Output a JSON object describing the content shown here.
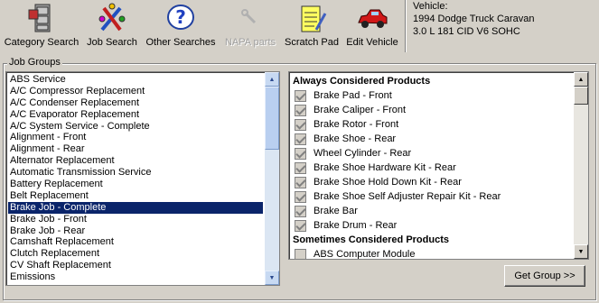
{
  "toolbar": {
    "buttons": [
      {
        "label": "Category Search",
        "icon": "file-cabinet-icon",
        "enabled": true
      },
      {
        "label": "Job Search",
        "icon": "tools-icon",
        "enabled": true
      },
      {
        "label": "Other Searches",
        "icon": "question-icon",
        "enabled": true
      },
      {
        "label": "NAPA parts",
        "icon": "wrench-icon",
        "enabled": false
      },
      {
        "label": "Scratch Pad",
        "icon": "notepad-icon",
        "enabled": true
      },
      {
        "label": "Edit Vehicle",
        "icon": "car-icon",
        "enabled": true
      }
    ]
  },
  "vehicle": {
    "heading": "Vehicle:",
    "line1": "1994 Dodge Truck Caravan",
    "line2": "3.0 L 181 CID V6 SOHC"
  },
  "job_groups": {
    "title": "Job Groups",
    "items": [
      "ABS Service",
      "A/C Compressor Replacement",
      "A/C Condenser Replacement",
      "A/C Evaporator Replacement",
      "A/C System Service - Complete",
      "Alignment - Front",
      "Alignment - Rear",
      "Alternator Replacement",
      "Automatic Transmission Service",
      "Battery Replacement",
      "Belt Replacement",
      "Brake Job - Complete",
      "Brake Job - Front",
      "Brake Job - Rear",
      "Camshaft Replacement",
      "Clutch Replacement",
      "CV Shaft Replacement",
      "Emissions"
    ],
    "selected": "Brake Job - Complete"
  },
  "products": {
    "always_heading": "Always Considered Products",
    "always": [
      "Brake Pad - Front",
      "Brake Caliper - Front",
      "Brake Rotor - Front",
      "Brake Shoe - Rear",
      "Wheel Cylinder - Rear",
      "Brake Shoe Hardware Kit - Rear",
      "Brake Shoe Hold Down Kit - Rear",
      "Brake Shoe Self Adjuster Repair Kit - Rear",
      "Brake Bar",
      "Brake Drum - Rear"
    ],
    "sometimes_heading": "Sometimes Considered Products",
    "sometimes": [
      "ABS Computer Module"
    ]
  },
  "get_group_label": "Get Group >>",
  "colors": {
    "selection": "#0a246a",
    "window_bg": "#d4d0c8"
  }
}
